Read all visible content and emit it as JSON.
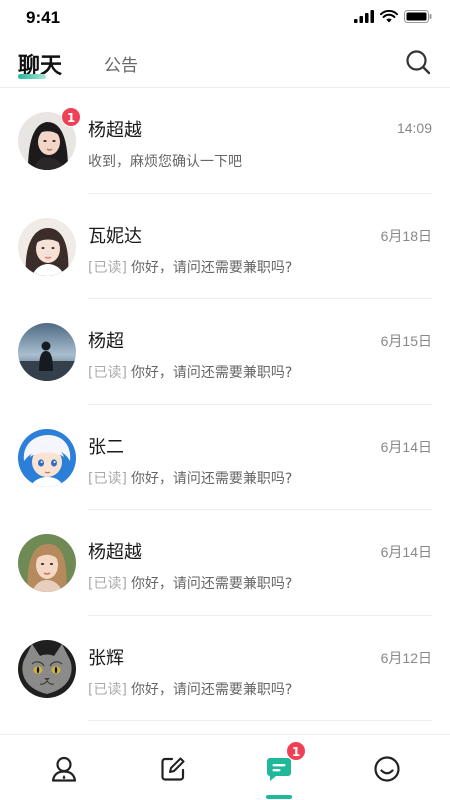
{
  "status_bar": {
    "time": "9:41"
  },
  "header": {
    "tabs": [
      {
        "label": "聊天",
        "active": true
      },
      {
        "label": "公告",
        "active": false
      }
    ],
    "search_icon": "search-icon"
  },
  "conversations": [
    {
      "name": "杨超越",
      "date": "14:09",
      "read_tag": "",
      "message": "收到，麻烦您确认一下吧",
      "unread": "1",
      "avatar": "portrait-dark-hair"
    },
    {
      "name": "瓦妮达",
      "date": "6月18日",
      "read_tag": "[已读]",
      "message": "你好，请问还需要兼职吗?",
      "unread": "",
      "avatar": "portrait-light"
    },
    {
      "name": "杨超",
      "date": "6月15日",
      "read_tag": "[已读]",
      "message": "你好，请问还需要兼职吗?",
      "unread": "",
      "avatar": "silhouette-sky"
    },
    {
      "name": "张二",
      "date": "6月14日",
      "read_tag": "[已读]",
      "message": "你好，请问还需要兼职吗?",
      "unread": "",
      "avatar": "anime-boy"
    },
    {
      "name": "杨超越",
      "date": "6月14日",
      "read_tag": "[已读]",
      "message": "你好，请问还需要兼职吗?",
      "unread": "",
      "avatar": "portrait-blonde"
    },
    {
      "name": "张辉",
      "date": "6月12日",
      "read_tag": "[已读]",
      "message": "你好，请问还需要兼职吗?",
      "unread": "",
      "avatar": "cat"
    }
  ],
  "tabbar": {
    "items": [
      {
        "icon": "contacts-icon",
        "active": false
      },
      {
        "icon": "edit-icon",
        "active": false
      },
      {
        "icon": "messages-icon",
        "active": true,
        "badge": "1"
      },
      {
        "icon": "smiley-icon",
        "active": false
      }
    ]
  },
  "colors": {
    "accent": "#1fb89a",
    "badge": "#ef4056"
  }
}
